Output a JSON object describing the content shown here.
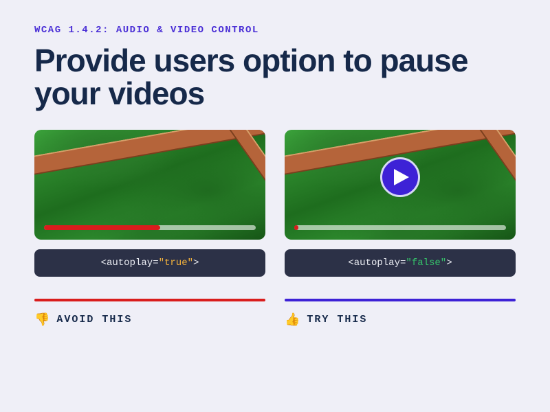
{
  "eyebrow": "WCAG 1.4.2: AUDIO & VIDEO CONTROL",
  "headline": "Provide users option to pause your videos",
  "examples": {
    "avoid": {
      "code_prefix": "<autoplay=",
      "code_value": "\"true\"",
      "code_suffix": ">",
      "progress_percent": 55,
      "verdict_emoji": "👎",
      "verdict_label": "AVOID THIS"
    },
    "try": {
      "code_prefix": "<autoplay=",
      "code_value": "\"false\"",
      "code_suffix": ">",
      "progress_percent": 2,
      "verdict_emoji": "👍",
      "verdict_label": "TRY THIS"
    }
  }
}
